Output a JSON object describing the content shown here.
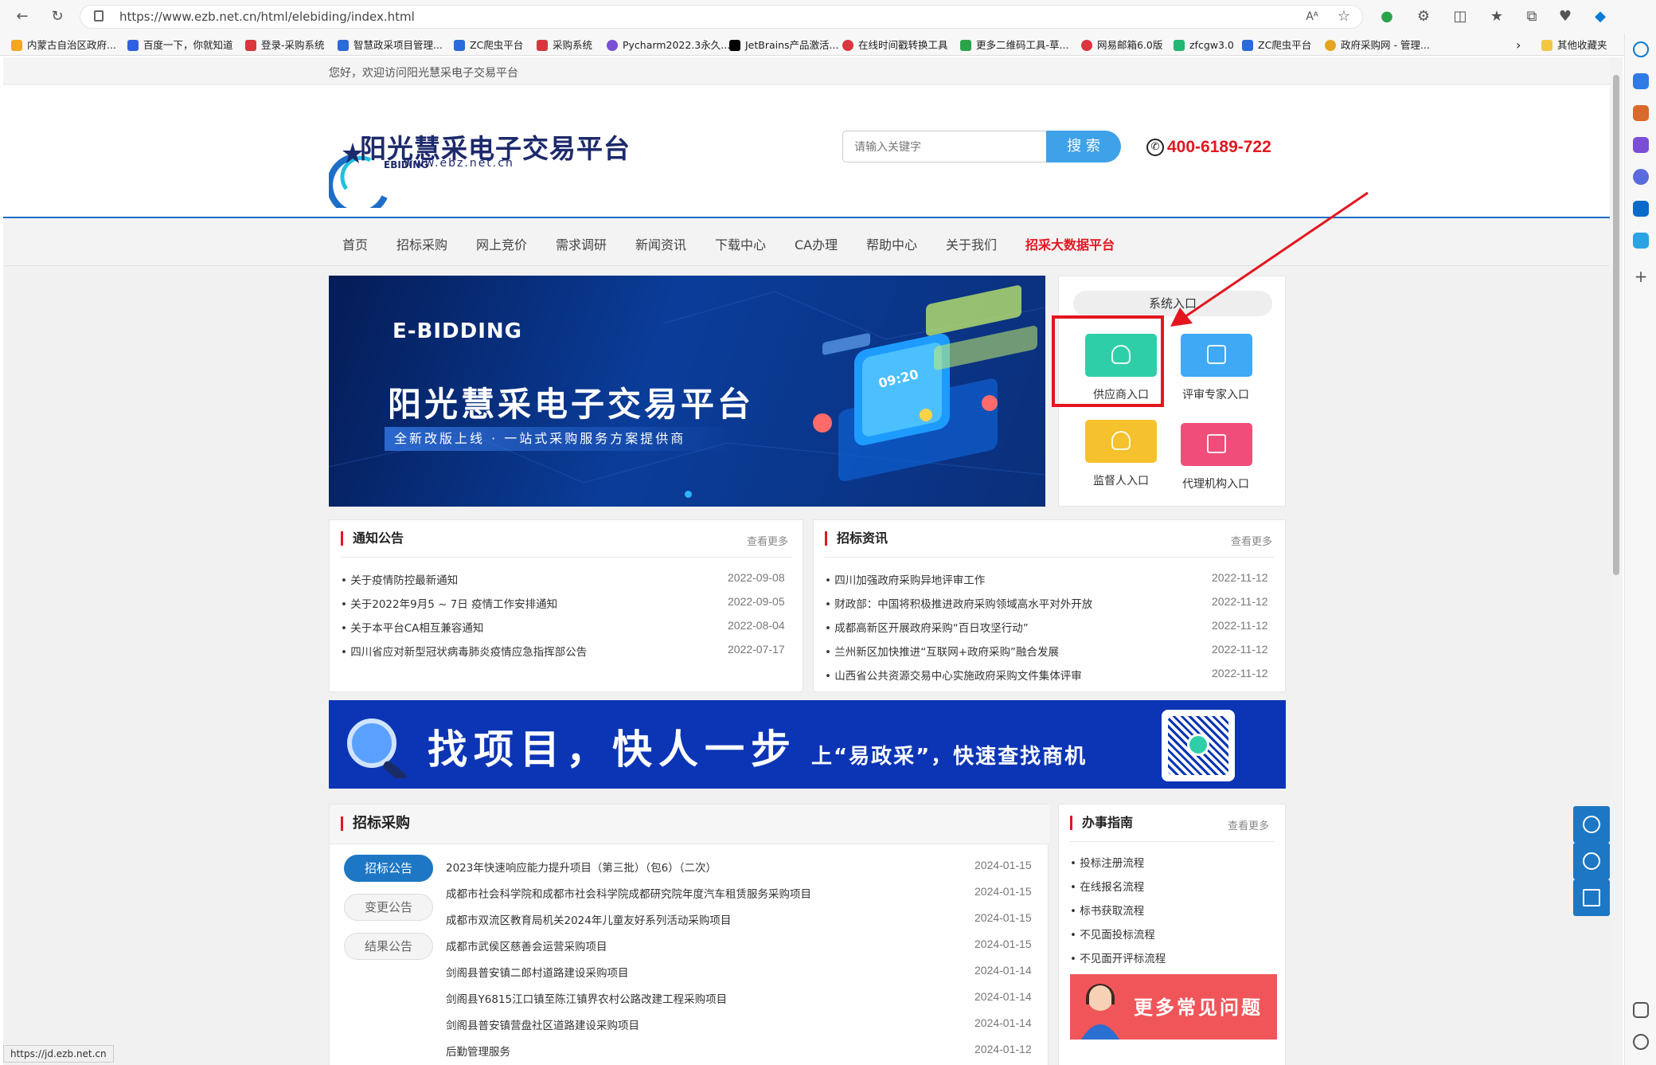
{
  "browser": {
    "url": "https://www.ezb.net.cn/html/elebiding/index.html",
    "bookmarks": [
      "内蒙古自治区政府...",
      "百度一下，你就知道",
      "登录-采购系统",
      "智慧政采项目管理...",
      "ZC爬虫平台",
      "采购系统",
      "Pycharm2022.3永久...",
      "JetBrains产品激活...",
      "在线时间戳转换工具",
      "更多二维码工具-草...",
      "网易邮箱6.0版",
      "zfcgw3.0",
      "ZC爬虫平台",
      "政府采购网 - 管理...",
      "其他收藏夹"
    ],
    "status_url": "https://jd.ezb.net.cn"
  },
  "top": {
    "welcome": "您好，欢迎访问阳光慧采电子交易平台"
  },
  "header": {
    "logo_title": "阳光慧采电子交易平台",
    "logo_eb": "EBIDING",
    "logo_url": "www.ebz.net.cn",
    "search_placeholder": "请输入关键字",
    "search_button": "搜 索",
    "phone": "400-6189-722"
  },
  "nav": {
    "items": [
      "首页",
      "招标采购",
      "网上竞价",
      "需求调研",
      "新闻资讯",
      "下载中心",
      "CA办理",
      "帮助中心",
      "关于我们",
      "招采大数据平台"
    ]
  },
  "banner": {
    "eyebrow": "E-BIDDING",
    "title": "阳光慧采电子交易平台",
    "subtitle": "全新改版上线 · 一站式采购服务方案提供商",
    "phone_time": "09:20"
  },
  "system_entry": {
    "title": "系统入口",
    "items": [
      {
        "label": "供应商入口",
        "color": "#2ecfa8",
        "icon": "user-check-icon"
      },
      {
        "label": "评审专家入口",
        "color": "#3fa9f5",
        "icon": "id-card-icon"
      },
      {
        "label": "监督人入口",
        "color": "#f5c12c",
        "icon": "user-lock-icon"
      },
      {
        "label": "代理机构入口",
        "color": "#f04d7a",
        "icon": "monitor-icon"
      }
    ]
  },
  "notice": {
    "title": "通知公告",
    "more": "查看更多",
    "items": [
      {
        "text": "关于疫情防控最新通知",
        "date": "2022-09-08"
      },
      {
        "text": "关于2022年9月5 ~ 7日 疫情工作安排通知",
        "date": "2022-09-05"
      },
      {
        "text": "关于本平台CA相互兼容通知",
        "date": "2022-08-04"
      },
      {
        "text": "四川省应对新型冠状病毒肺炎疫情应急指挥部公告",
        "date": "2022-07-17"
      }
    ]
  },
  "news": {
    "title": "招标资讯",
    "more": "查看更多",
    "items": [
      {
        "text": "四川加强政府采购异地评审工作",
        "date": "2022-11-12"
      },
      {
        "text": "财政部：中国将积极推进政府采购领域高水平对外开放",
        "date": "2022-11-12"
      },
      {
        "text": "成都高新区开展政府采购“百日攻坚行动”",
        "date": "2022-11-12"
      },
      {
        "text": "兰州新区加快推进“互联网+政府采购”融合发展",
        "date": "2022-11-12"
      },
      {
        "text": "山西省公共资源交易中心实施政府采购文件集体评审",
        "date": "2022-11-12"
      }
    ]
  },
  "ad": {
    "main": "找项目，快人一步",
    "sub": "上“易政采”，快速查找商机"
  },
  "procurement": {
    "title": "招标采购",
    "tabs": [
      "招标公告",
      "变更公告",
      "结果公告"
    ],
    "items": [
      {
        "text": "2023年快速响应能力提升项目（第三批）（包6）（二次）",
        "date": "2024-01-15"
      },
      {
        "text": "成都市社会科学院和成都市社会科学院成都研究院年度汽车租赁服务采购项目",
        "date": "2024-01-15"
      },
      {
        "text": "成都市双流区教育局机关2024年儿童友好系列活动采购项目",
        "date": "2024-01-15"
      },
      {
        "text": "成都市武侯区慈善会运营采购项目",
        "date": "2024-01-15"
      },
      {
        "text": "剑阁县普安镇二郎村道路建设采购项目",
        "date": "2024-01-14"
      },
      {
        "text": "剑阁县Y6815江口镇至陈江镇界农村公路改建工程采购项目",
        "date": "2024-01-14"
      },
      {
        "text": "剑阁县普安镇营盘社区道路建设采购项目",
        "date": "2024-01-14"
      },
      {
        "text": "后勤管理服务",
        "date": "2024-01-12"
      }
    ]
  },
  "guide": {
    "title": "办事指南",
    "more": "查看更多",
    "items": [
      "投标注册流程",
      "在线报名流程",
      "标书获取流程",
      "不见面投标流程",
      "不见面开评标流程"
    ],
    "faq": "更多常见问题"
  }
}
